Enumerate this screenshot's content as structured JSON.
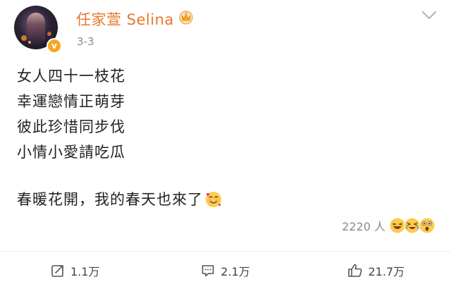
{
  "author": {
    "name": "任家萱 Selina",
    "verified": true,
    "date": "3-3"
  },
  "post": {
    "lines": [
      "女人四十一枝花",
      "幸運戀情正萌芽",
      "彼此珍惜同步伐",
      "小情小愛請吃瓜"
    ],
    "final_line": "春暖花開，我的春天也來了"
  },
  "reactions": {
    "count": "2220 人",
    "emojis": [
      "laughing-face-icon",
      "squinting-laugh-icon",
      "astonished-face-icon"
    ]
  },
  "actions": {
    "share": "1.1万",
    "comment": "2.1万",
    "like": "21.7万"
  },
  "colors": {
    "username": "#e8772e",
    "verified_badge": "#f5a623",
    "meta_text": "#8a8a8a"
  }
}
